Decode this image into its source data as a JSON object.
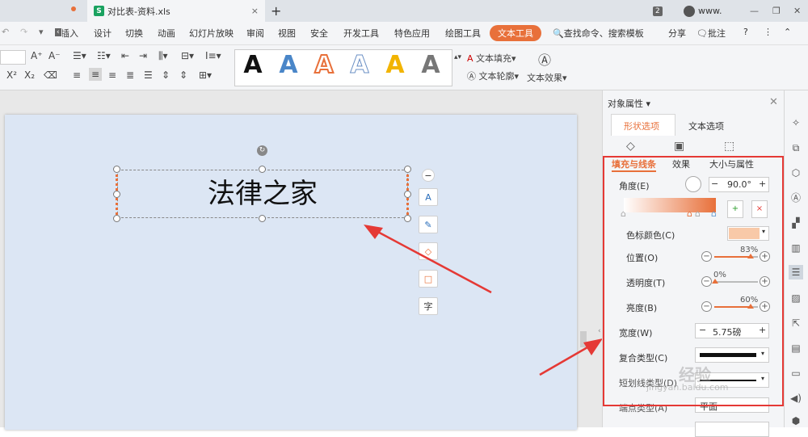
{
  "tabs": {
    "file_tab": "对比表-资料.xls",
    "new_tab": "+",
    "badge": "2",
    "user": "www."
  },
  "ribbon": {
    "tabs": [
      "插入",
      "设计",
      "切换",
      "动画",
      "幻灯片放映",
      "审阅",
      "视图",
      "安全",
      "开发工具",
      "特色应用",
      "绘图工具",
      "文本工具"
    ],
    "tab_partial": "插入",
    "active": "文本工具",
    "search": "查找命令、搜索模板",
    "share": "分享",
    "comment": "批注"
  },
  "toolbar": {
    "text_fill": "文本填充",
    "text_outline": "文本轮廓",
    "text_effect": "文本效果",
    "styles": [
      "A",
      "A",
      "A",
      "A",
      "A",
      "A"
    ],
    "style_colors": [
      "#111111",
      "#4a86c8",
      "#e8703a",
      "#c9d8ee",
      "#f2b400",
      "#777777"
    ]
  },
  "slide": {
    "text": "法律之家",
    "side_tools": [
      "−",
      "A",
      "✎",
      "◇",
      "□",
      "字"
    ]
  },
  "panel": {
    "title": "对象属性",
    "main_tabs": [
      "形状选项",
      "文本选项"
    ],
    "sub_tabs": [
      "填充与线条",
      "效果",
      "大小与属性"
    ],
    "angle_label": "角度(E)",
    "angle_value": "90.0°",
    "stop_color_label": "色标颜色(C)",
    "stop_color": "#f8c9a8",
    "position_label": "位置(O)",
    "position_value": "83%",
    "transparency_label": "透明度(T)",
    "transparency_value": "0%",
    "brightness_label": "亮度(B)",
    "brightness_value": "60%",
    "width_label": "宽度(W)",
    "width_value": "5.75磅",
    "compound_label": "复合类型(C)",
    "dash_label": "短划线类型(D)",
    "end_label": "端点类型(A)",
    "end_value": "平面"
  },
  "watermark": "经验",
  "watermark_url": "jingyan.baidu.com"
}
